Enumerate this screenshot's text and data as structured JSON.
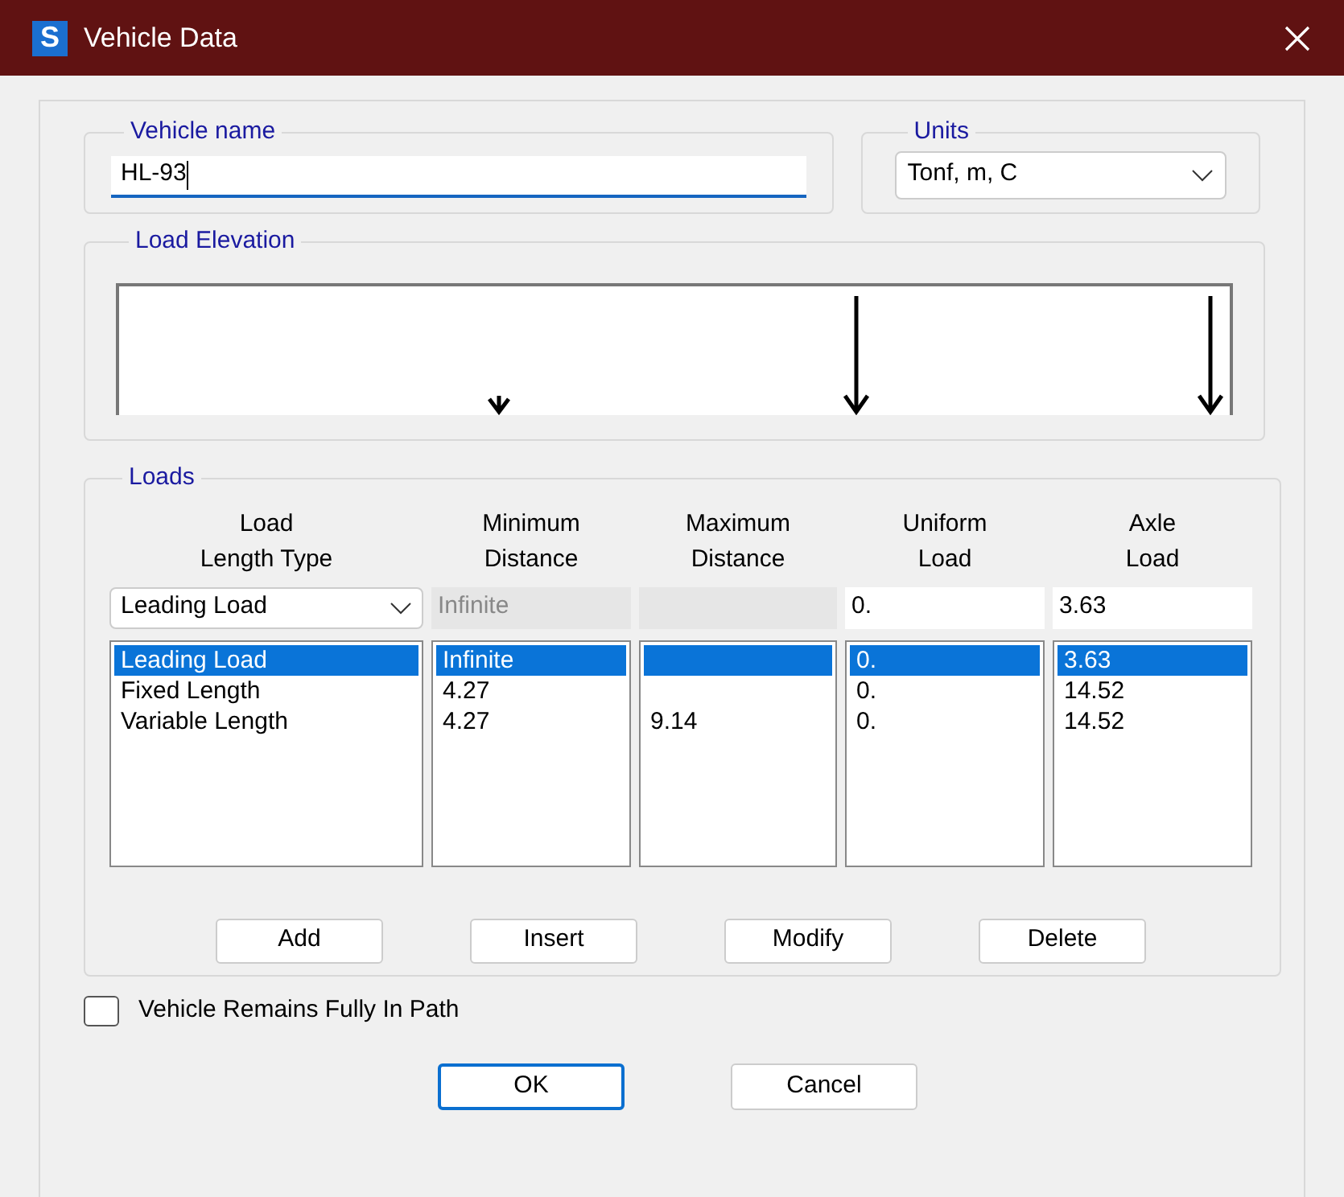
{
  "window": {
    "title": "Vehicle Data",
    "icon_letter": "S"
  },
  "vehicle_name": {
    "label": "Vehicle name",
    "value": "HL-93"
  },
  "units": {
    "label": "Units",
    "value": "Tonf, m, C"
  },
  "load_elevation": {
    "label": "Load Elevation"
  },
  "loads": {
    "label": "Loads",
    "columns": [
      {
        "lines": [
          "Load",
          "Length Type"
        ]
      },
      {
        "lines": [
          "Minimum",
          "Distance"
        ]
      },
      {
        "lines": [
          "Maximum",
          "Distance"
        ]
      },
      {
        "lines": [
          "Uniform",
          "Load"
        ]
      },
      {
        "lines": [
          "Axle",
          "Load"
        ]
      }
    ],
    "editor": {
      "type": "Leading Load",
      "min": "Infinite",
      "min_disabled": true,
      "max_disabled": true,
      "uniform": "0.",
      "axle": "3.63"
    },
    "rows": [
      {
        "type": "Leading Load",
        "min": "Infinite",
        "uniform": "0.",
        "axle": "3.63",
        "selected": true
      },
      {
        "type": "Fixed Length",
        "min": "4.27",
        "uniform": "0.",
        "axle": "14.52",
        "selected": false
      },
      {
        "type": "Variable Length",
        "min": "4.27",
        "max": "9.14",
        "uniform": "0.",
        "axle": "14.52",
        "selected": false
      }
    ],
    "buttons": [
      "Add",
      "Insert",
      "Modify",
      "Delete"
    ]
  },
  "remains_in_path": {
    "label": "Vehicle Remains Fully In Path",
    "checked": false
  },
  "buttons": [
    {
      "label": "OK",
      "default": true
    },
    {
      "label": "Cancel",
      "default": false
    }
  ]
}
